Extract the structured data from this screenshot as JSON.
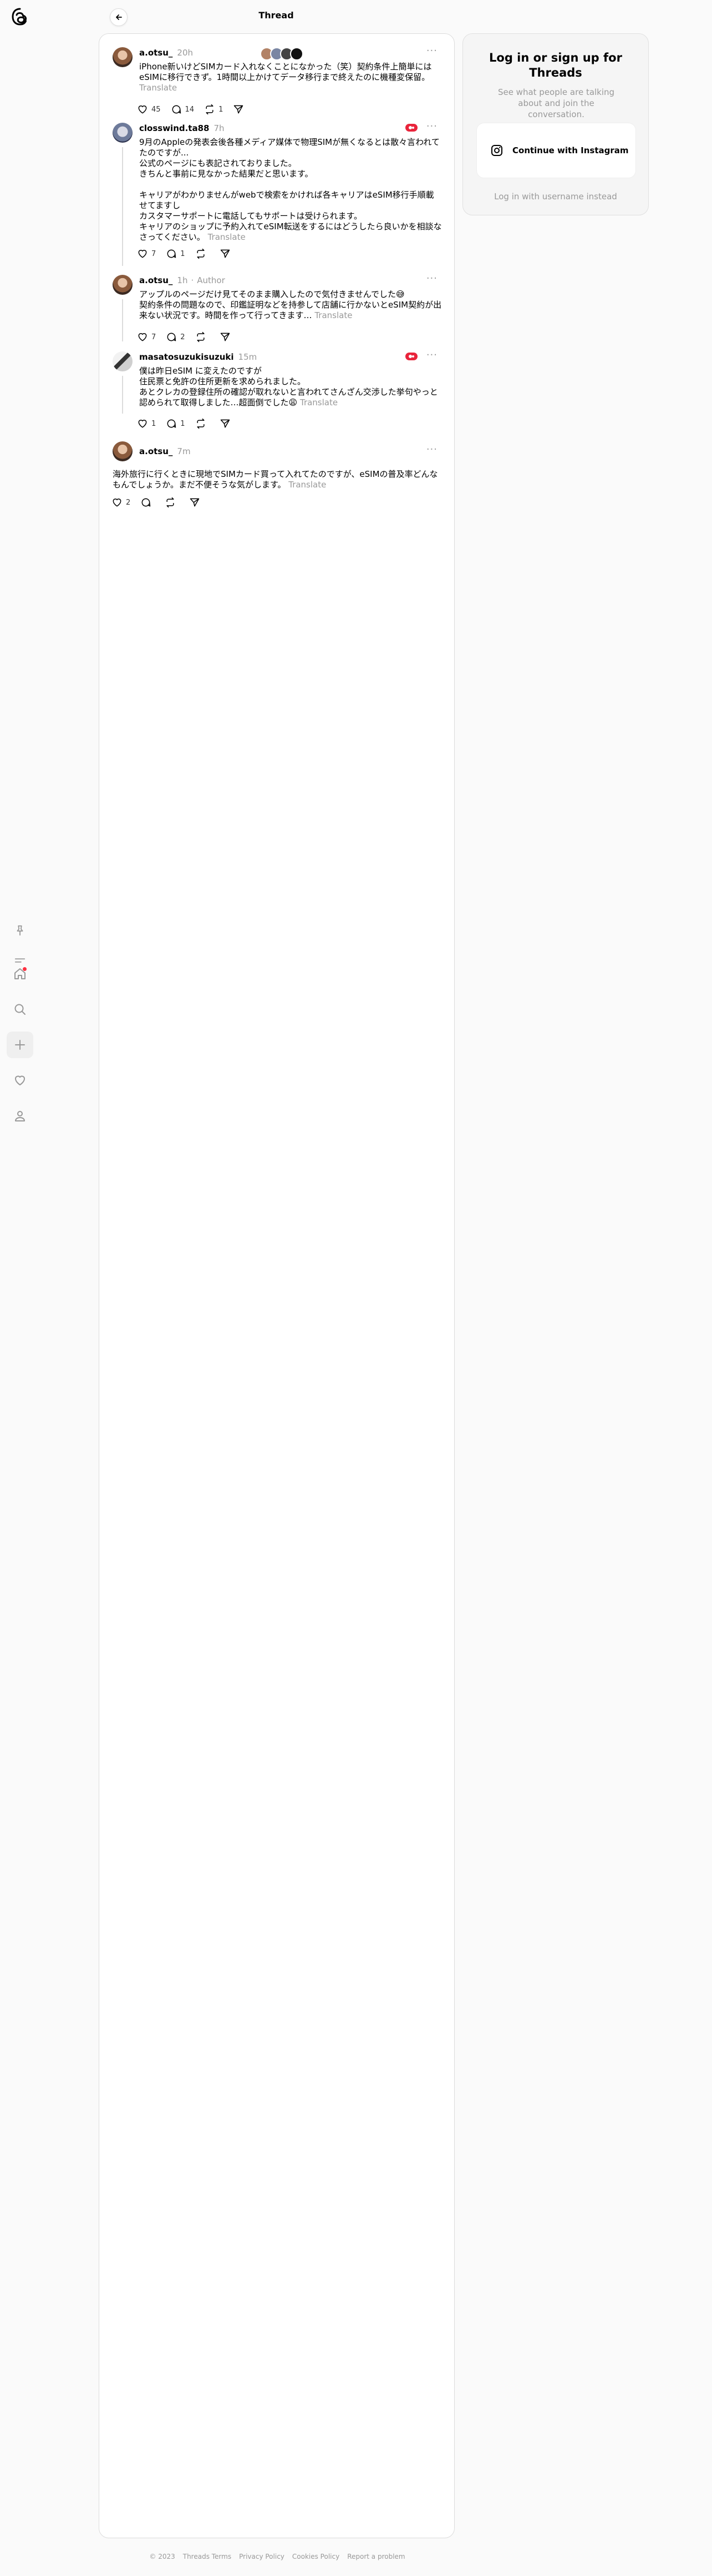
{
  "header": {
    "title": "Thread"
  },
  "nav": {
    "items": [
      {
        "name": "home"
      },
      {
        "name": "search"
      },
      {
        "name": "create"
      },
      {
        "name": "activity"
      },
      {
        "name": "profile"
      }
    ]
  },
  "thread": {
    "main_post": {
      "username": "a.otsu_",
      "time": "20h",
      "text": "iPhone新いけどSIMカード入れなくことになかった（笑）契約条件上簡単にはeSIMに移行できず。1時間以上かけてデータ移行まで終えたのに機種変保留。",
      "translate": "Translate",
      "likes": "45",
      "comments": "14",
      "reposts": "1"
    },
    "replies": [
      {
        "username": "closswind.ta88",
        "time": "7h",
        "text": "9月のAppleの発表会後各種メディア媒体で物理SIMが無くなるとは散々言われてたのですが...\n公式のページにも表記されておりました。\nきちんと事前に見なかった結果だと思います。\n\nキャリアがわかりませんがwebで検索をかければ各キャリアはeSIM移行手順載せてますし\nカスタマーサポートに電話してもサポートは受けられます。\nキャリアのショップに予約入れてeSIM転送をするにはどうしたら良いかを相談なさってください。",
        "translate": "Translate",
        "likes": "7",
        "comments": "1"
      },
      {
        "username": "a.otsu_",
        "time": "1h",
        "role": "Author",
        "text": "アップルのページだけ見てそのまま購入したので気付きませんでした😅\n契約条件の問題なので、印鑑証明などを持参して店舗に行かないとeSIM契約が出来ない状況です。時間を作って行ってきます…",
        "translate": "Translate",
        "likes": "7",
        "comments": "2"
      },
      {
        "username": "masatosuzukisuzuki",
        "time": "15m",
        "text": "僕は昨日eSIM に変えたのですが\n住民票と免許の住所更新を求められました。\nあとクレカの登録住所の確認が取れないと言われてさんざん交渉した挙句やっと認められて取得しました…超面倒でした😩",
        "translate": "Translate",
        "likes": "1",
        "comments": "1"
      }
    ],
    "last_post": {
      "username": "a.otsu_",
      "time": "7m",
      "text": "海外旅行に行くときに現地でSIMカード買って入れてたのですが、eSIMの普及率どんなもんでしょうか。まだ不便そうな気がします。",
      "translate": "Translate",
      "likes": "2"
    }
  },
  "login": {
    "title": "Log in or sign up for Threads",
    "subtitle": "See what people are talking about and join the conversation.",
    "instagram_label": "Continue with Instagram",
    "username_link": "Log in with username instead"
  },
  "footer": {
    "copyright": "© 2023",
    "links": [
      "Threads Terms",
      "Privacy Policy",
      "Cookies Policy",
      "Report a problem"
    ]
  },
  "colors": {
    "notification_dot": "#ff3040",
    "muted_text": "#999999",
    "badge_red": "#e9243b"
  }
}
